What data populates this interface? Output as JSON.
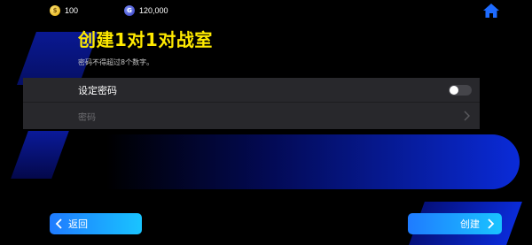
{
  "currencies": [
    {
      "icon": "gold-coin-icon",
      "value": "100"
    },
    {
      "icon": "gem-coin-icon",
      "value": "120,000"
    }
  ],
  "home_icon": "home-icon",
  "title": "创建1对1对战室",
  "hint": "密码不得超过8个数字。",
  "settings": {
    "set_password_label": "设定密码",
    "set_password_enabled": false,
    "password_label": "密码"
  },
  "buttons": {
    "back_label": "返回",
    "create_label": "创建"
  },
  "colors": {
    "title": "#ffea00",
    "button_gradient_start": "#1f7bff",
    "button_gradient_end": "#19c4ff",
    "panel": "#28282c",
    "home_icon": "#1e6bff"
  }
}
